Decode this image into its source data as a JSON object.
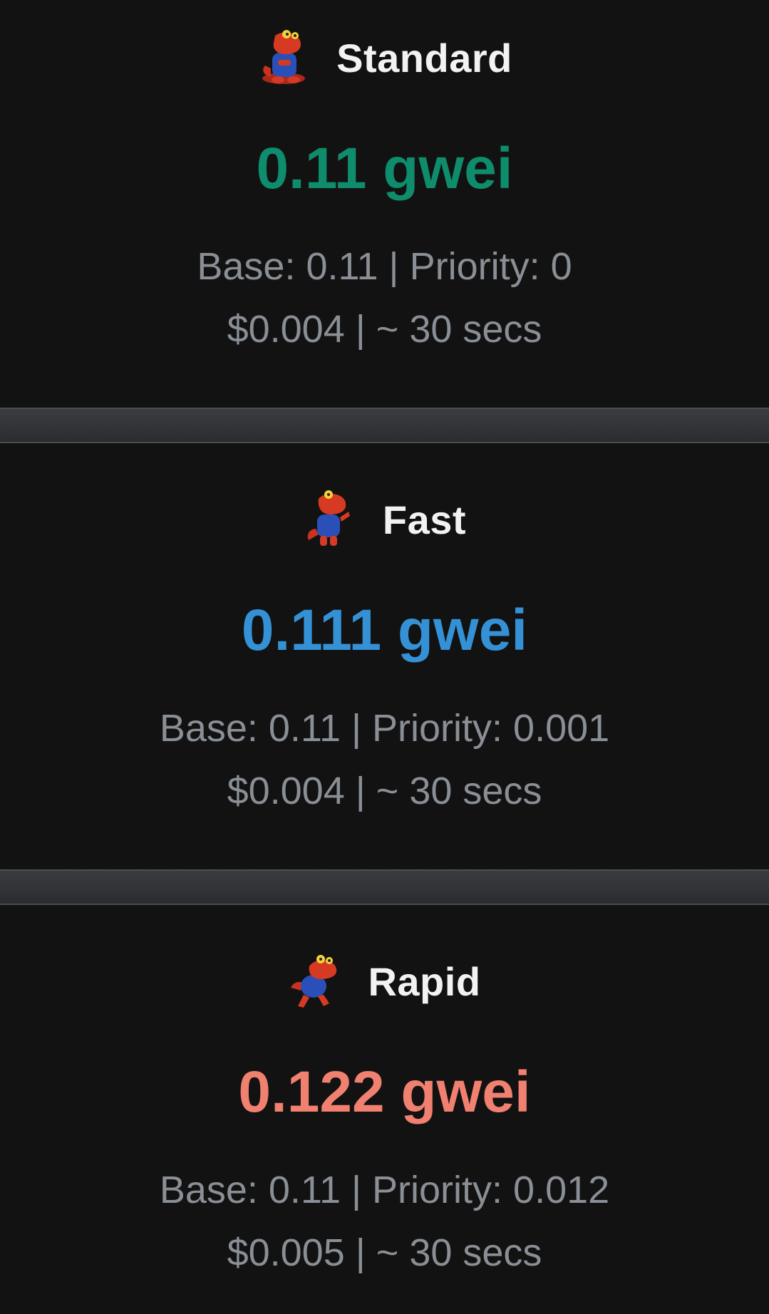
{
  "colors": {
    "standard": "#0e8c6b",
    "fast": "#3591d6",
    "rapid": "#f0806f",
    "label": "#f2f2f2",
    "detail": "#8a8f96",
    "background": "#121212"
  },
  "tiers": [
    {
      "label": "Standard",
      "icon": "dinosaur-mascot-sitting-icon",
      "gas_price": "0.11 gwei",
      "breakdown": "Base: 0.11 | Priority: 0",
      "cost_time": "$0.004 | ~ 30 secs"
    },
    {
      "label": "Fast",
      "icon": "dinosaur-mascot-walking-icon",
      "gas_price": "0.111 gwei",
      "breakdown": "Base: 0.11 | Priority: 0.001",
      "cost_time": "$0.004 | ~ 30 secs"
    },
    {
      "label": "Rapid",
      "icon": "dinosaur-mascot-running-icon",
      "gas_price": "0.122 gwei",
      "breakdown": "Base: 0.11 | Priority: 0.012",
      "cost_time": "$0.005 | ~ 30 secs"
    }
  ]
}
